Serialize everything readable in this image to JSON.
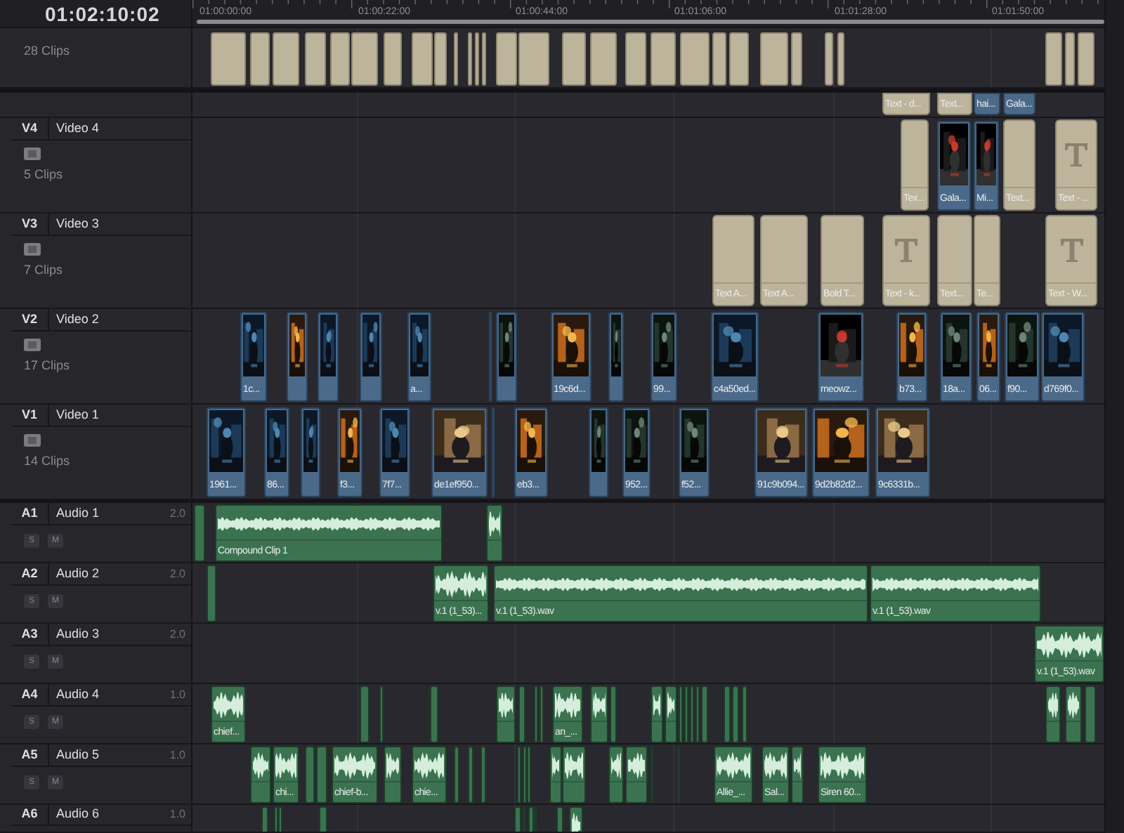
{
  "timecode": "01:02:10:02",
  "ruler": {
    "ticks": [
      "01:00:00:00",
      "01:00:22:00",
      "01:00:44:00",
      "01:01:06:00",
      "01:01:28:00",
      "01:01:50:00"
    ]
  },
  "tracks": [
    {
      "kind": "compound",
      "clip_count": "28 Clips",
      "clips": [
        {
          "kind": "title"
        },
        {
          "kind": "title"
        },
        {
          "kind": "title"
        },
        {
          "kind": "title"
        },
        {
          "kind": "title"
        },
        {
          "kind": "title"
        },
        {
          "kind": "title"
        },
        {
          "kind": "title"
        },
        {
          "kind": "title"
        },
        {
          "kind": "title"
        },
        {
          "kind": "title"
        },
        {
          "kind": "title"
        },
        {
          "kind": "title"
        },
        {
          "kind": "title"
        },
        {
          "kind": "title"
        },
        {
          "kind": "title"
        },
        {
          "kind": "title"
        },
        {
          "kind": "title"
        },
        {
          "kind": "title"
        },
        {
          "kind": "title"
        },
        {
          "kind": "title"
        },
        {
          "kind": "title"
        },
        {
          "kind": "title"
        },
        {
          "kind": "title"
        },
        {
          "kind": "title"
        },
        {
          "kind": "title"
        },
        {
          "kind": "title"
        },
        {
          "kind": "title"
        },
        {
          "kind": "title"
        }
      ]
    },
    {
      "kind": "partial",
      "clips": [
        {
          "kind": "title",
          "label": "Text - d..."
        },
        {
          "kind": "title",
          "label": "Text..."
        },
        {
          "kind": "video",
          "label": "hai..."
        },
        {
          "kind": "video",
          "label": "Gala..."
        }
      ]
    },
    {
      "kind": "video",
      "code": "V4",
      "name": "Video 4",
      "clip_count": "5 Clips",
      "clips": [
        {
          "kind": "title",
          "label": "Tex..."
        },
        {
          "kind": "video",
          "label": "Gala..."
        },
        {
          "kind": "video",
          "label": "Mi..."
        },
        {
          "kind": "title",
          "label": "Text..."
        },
        {
          "kind": "text_title",
          "label": "Text - ..."
        }
      ]
    },
    {
      "kind": "video",
      "code": "V3",
      "name": "Video 3",
      "clip_count": "7 Clips",
      "clips": [
        {
          "kind": "title",
          "label": "Text A..."
        },
        {
          "kind": "title",
          "label": "Text A..."
        },
        {
          "kind": "title",
          "label": "Bold T..."
        },
        {
          "kind": "text_title",
          "label": "Text - k..."
        },
        {
          "kind": "title",
          "label": "Text..."
        },
        {
          "kind": "title",
          "label": "Te..."
        },
        {
          "kind": "text_title",
          "label": "Text - W..."
        }
      ]
    },
    {
      "kind": "video",
      "code": "V2",
      "name": "Video 2",
      "clip_count": "17 Clips",
      "clips": [
        {
          "kind": "video",
          "label": "1c..."
        },
        {
          "kind": "video"
        },
        {
          "kind": "video"
        },
        {
          "kind": "video"
        },
        {
          "kind": "video",
          "label": "a..."
        },
        {
          "kind": "video"
        },
        {
          "kind": "video"
        },
        {
          "kind": "video",
          "label": "19c6d..."
        },
        {
          "kind": "video"
        },
        {
          "kind": "video",
          "label": "99..."
        },
        {
          "kind": "video",
          "label": "c4a50ed..."
        },
        {
          "kind": "video",
          "label": "meowz..."
        },
        {
          "kind": "video",
          "label": "b73..."
        },
        {
          "kind": "video",
          "label": "18a..."
        },
        {
          "kind": "video",
          "label": "06..."
        },
        {
          "kind": "video",
          "label": "f90..."
        },
        {
          "kind": "video",
          "label": "d769f0..."
        }
      ]
    },
    {
      "kind": "video",
      "code": "V1",
      "name": "Video 1",
      "clip_count": "14 Clips",
      "clips": [
        {
          "kind": "video",
          "label": "1961..."
        },
        {
          "kind": "video",
          "label": "86..."
        },
        {
          "kind": "video"
        },
        {
          "kind": "video",
          "label": "f3..."
        },
        {
          "kind": "video",
          "label": "7f7..."
        },
        {
          "kind": "video",
          "label": "de1ef950..."
        },
        {
          "kind": "video"
        },
        {
          "kind": "video",
          "label": "eb3..."
        },
        {
          "kind": "video"
        },
        {
          "kind": "video",
          "label": "952..."
        },
        {
          "kind": "video",
          "label": "f52..."
        },
        {
          "kind": "video",
          "label": "91c9b094..."
        },
        {
          "kind": "video",
          "label": "9d2b82d2..."
        },
        {
          "kind": "video",
          "label": "9c6331b..."
        }
      ]
    },
    {
      "kind": "audio",
      "code": "A1",
      "name": "Audio 1",
      "channels": "2.0",
      "solo": "S",
      "mute": "M",
      "clips": [
        {
          "kind": "audio"
        },
        {
          "kind": "audio",
          "label": "Compound Clip 1"
        },
        {
          "kind": "audio"
        }
      ]
    },
    {
      "kind": "audio",
      "code": "A2",
      "name": "Audio 2",
      "channels": "2.0",
      "solo": "S",
      "mute": "M",
      "clips": [
        {
          "kind": "audio"
        },
        {
          "kind": "audio",
          "label": "v.1 (1_53)..."
        },
        {
          "kind": "audio",
          "label": "v.1 (1_53).wav"
        },
        {
          "kind": "audio",
          "label": "v.1 (1_53).wav"
        }
      ]
    },
    {
      "kind": "audio",
      "code": "A3",
      "name": "Audio 3",
      "channels": "2.0",
      "solo": "S",
      "mute": "M",
      "clips": [
        {
          "kind": "audio",
          "label": "v.1 (1_53).wav"
        }
      ]
    },
    {
      "kind": "audio",
      "code": "A4",
      "name": "Audio 4",
      "channels": "1.0",
      "solo": "S",
      "mute": "M",
      "clips": [
        {
          "kind": "audio",
          "label": "chief..."
        },
        {
          "kind": "audio"
        },
        {
          "kind": "audio"
        },
        {
          "kind": "audio"
        },
        {
          "kind": "audio"
        },
        {
          "kind": "audio"
        },
        {
          "kind": "audio"
        },
        {
          "kind": "audio"
        },
        {
          "kind": "audio",
          "label": "an_..."
        },
        {
          "kind": "audio"
        },
        {
          "kind": "audio"
        },
        {
          "kind": "audio"
        },
        {
          "kind": "audio"
        },
        {
          "kind": "audio"
        },
        {
          "kind": "audio"
        },
        {
          "kind": "audio"
        },
        {
          "kind": "audio"
        },
        {
          "kind": "audio"
        },
        {
          "kind": "audio"
        },
        {
          "kind": "audio"
        },
        {
          "kind": "audio"
        },
        {
          "kind": "audio"
        },
        {
          "kind": "audio"
        },
        {
          "kind": "audio"
        }
      ]
    },
    {
      "kind": "audio",
      "code": "A5",
      "name": "Audio 5",
      "channels": "1.0",
      "solo": "S",
      "mute": "M",
      "clips": [
        {
          "kind": "audio"
        },
        {
          "kind": "audio",
          "label": "chi..."
        },
        {
          "kind": "audio"
        },
        {
          "kind": "audio"
        },
        {
          "kind": "audio",
          "label": "chief-b..."
        },
        {
          "kind": "audio"
        },
        {
          "kind": "audio",
          "label": "chie..."
        },
        {
          "kind": "audio"
        },
        {
          "kind": "audio"
        },
        {
          "kind": "audio"
        },
        {
          "kind": "audio"
        },
        {
          "kind": "audio"
        },
        {
          "kind": "audio"
        },
        {
          "kind": "audio"
        },
        {
          "kind": "audio"
        },
        {
          "kind": "audio"
        },
        {
          "kind": "audio"
        },
        {
          "kind": "audio"
        },
        {
          "kind": "audio"
        },
        {
          "kind": "audio",
          "label": "Allie_..."
        },
        {
          "kind": "audio",
          "label": "Sal..."
        },
        {
          "kind": "audio"
        },
        {
          "kind": "audio",
          "label": "Siren 60..."
        }
      ]
    },
    {
      "kind": "audio",
      "code": "A6",
      "name": "Audio 6",
      "channels": "1.0",
      "clips": [
        {
          "kind": "audio"
        },
        {
          "kind": "audio"
        },
        {
          "kind": "audio"
        },
        {
          "kind": "audio"
        },
        {
          "kind": "audio"
        },
        {
          "kind": "audio"
        },
        {
          "kind": "audio"
        },
        {
          "kind": "audio"
        },
        {
          "kind": "audio"
        },
        {
          "kind": "audio"
        }
      ]
    }
  ]
}
